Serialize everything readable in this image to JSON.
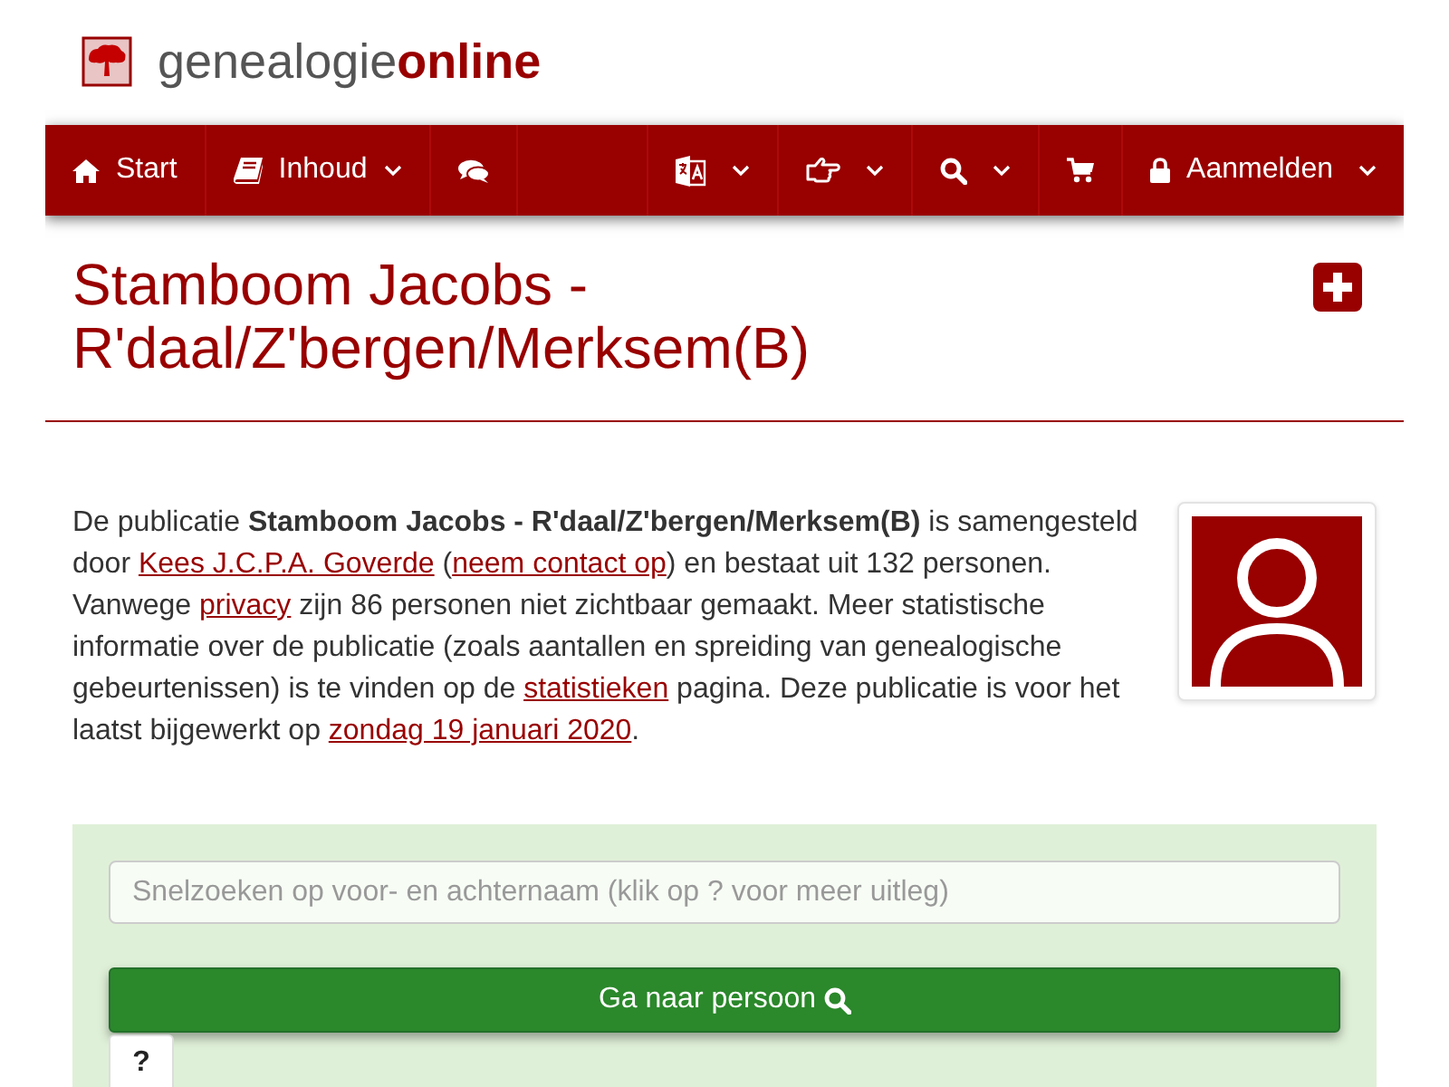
{
  "logo": {
    "text": "genealogie**online**"
  },
  "nav": {
    "left": [
      {
        "label": "Start",
        "dropdown": false
      },
      {
        "label": "Inhoud",
        "dropdown": true
      },
      {
        "dropdown": false
      }
    ],
    "right": [
      {
        "dropdown": true
      },
      {
        "dropdown": true
      },
      {
        "dropdown": true
      },
      {
        "dropdown": false
      },
      {
        "label": "Aanmelden",
        "dropdown": true
      }
    ]
  },
  "page": {
    "title": "Stamboom Jacobs - R'daal/Z'bergen/Merksem(B)"
  },
  "intro": {
    "parts": [
      {
        "kind": "text",
        "text": "De publicatie **Stamboom Jacobs - R'daal/Z'bergen/Merksem(B)** is samengesteld door "
      },
      {
        "kind": "link",
        "text": "Kees J.C.P.A. Goverde"
      },
      {
        "kind": "text",
        "text": " ("
      },
      {
        "kind": "link",
        "text": "neem contact op"
      },
      {
        "kind": "text",
        "text": ") en bestaat uit 132 personen. Vanwege "
      },
      {
        "kind": "link",
        "text": "privacy"
      },
      {
        "kind": "text",
        "text": " zijn 86 personen niet zichtbaar gemaakt. Meer statistische informatie over de publicatie (zoals aantallen en spreiding van genealogische gebeurtenissen) is te vinden op de "
      },
      {
        "kind": "link",
        "text": "statistieken"
      },
      {
        "kind": "text",
        "text": " pagina. Deze publicatie is voor het laatst bijgewerkt op "
      },
      {
        "kind": "link",
        "text": "zondag 19 januari 2020"
      },
      {
        "kind": "text",
        "text": "."
      }
    ]
  },
  "search": {
    "placeholder": "Snelzoeken op voor- en achternaam (klik op ? voor meer uitleg)",
    "button": "Ga naar persoon",
    "help": "?"
  }
}
